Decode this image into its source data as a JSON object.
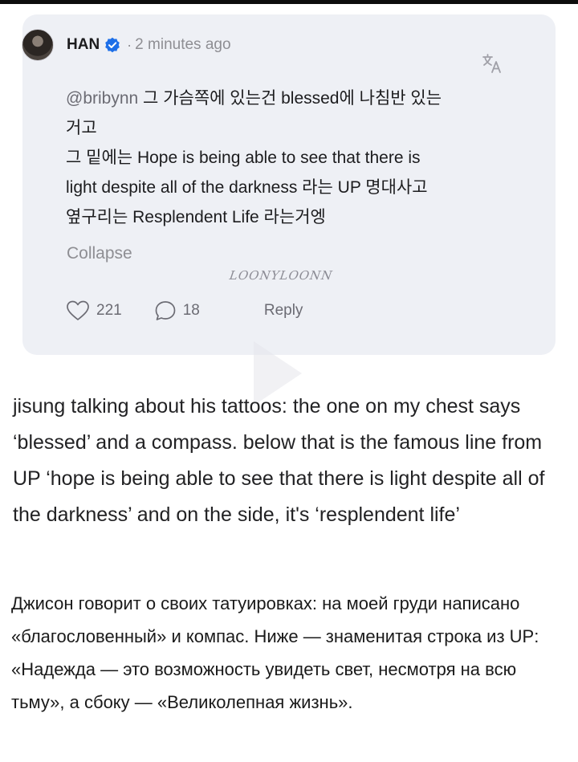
{
  "post": {
    "username": "HAN",
    "separator": "·",
    "time": "2 minutes ago",
    "mention": "@bribynn",
    "lines": [
      " 그 가슴쪽에 있는건 blessed에 나침반 있는",
      "거고",
      "그 밑에는 Hope is being able to see that there is",
      "light despite all of the darkness 라는 UP 명대사고",
      "옆구리는 Resplendent Life 라는거엥"
    ],
    "collapse_label": "Collapse",
    "watermark": "LOONYLOONN",
    "likes": "221",
    "replies": "18",
    "reply_label": "Reply",
    "icons": {
      "verified": "verified-badge-icon",
      "translate": "translate-icon",
      "like": "heart-icon",
      "comment": "comment-bubble-icon"
    },
    "colors": {
      "card_bg": "#eef0f5",
      "verified": "#1d6fe8",
      "muted": "#8e8e93"
    }
  },
  "caption_en": "jisung talking about his tattoos: the one on my chest says ‘blessed’ and a compass. below that is the famous line from UP ‘hope is being able to see that there is light despite all of the darkness’ and on the side, it's ‘resplendent life’",
  "caption_ru": "Джисон говорит о своих татуировках: на моей груди написано «благословенный» и компас. Ниже — знаменитая строка из UP: «Надежда — это возможность увидеть свет, несмотря на всю тьму», а сбоку — «Великолепная жизнь»."
}
